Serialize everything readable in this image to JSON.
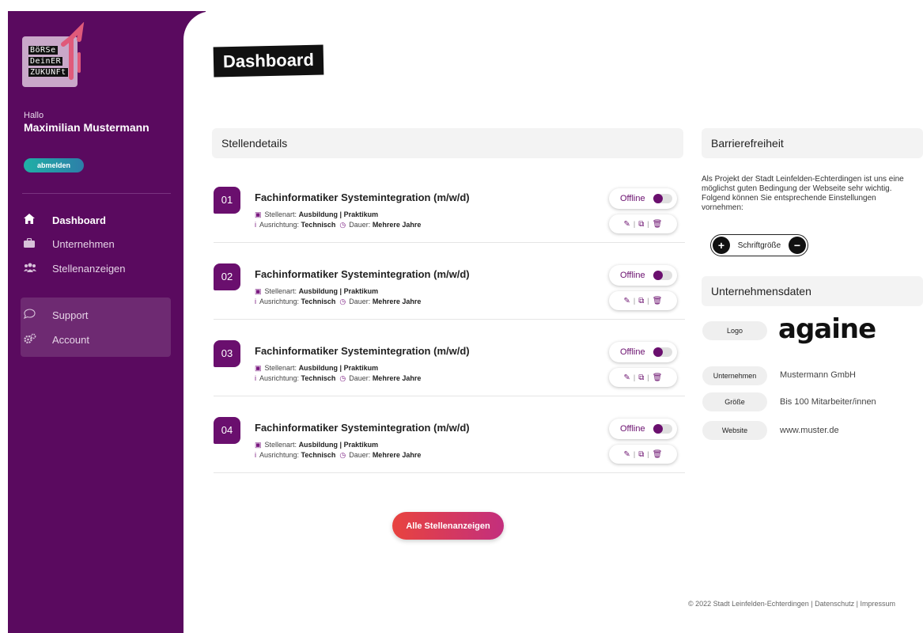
{
  "sidebar": {
    "logo_words": [
      "BöRSe",
      "DeinER",
      "ZUKUNFt"
    ],
    "greeting": "Hallo",
    "user_name": "Maximilian Mustermann",
    "logout_label": "abmelden",
    "nav": [
      {
        "label": "Dashboard",
        "icon": "home-icon",
        "active": true
      },
      {
        "label": "Unternehmen",
        "icon": "briefcase-icon",
        "active": false
      },
      {
        "label": "Stellenanzeigen",
        "icon": "users-icon",
        "active": false
      }
    ],
    "nav_secondary": [
      {
        "label": "Support",
        "icon": "chat-icon"
      },
      {
        "label": "Account",
        "icon": "gears-icon"
      }
    ]
  },
  "page_title": "Dashboard",
  "jobs_panel": {
    "title": "Stellendetails",
    "items": [
      {
        "num": "01",
        "title": "Fachinformatiker Systemintegration (m/w/d)",
        "type_label": "Stellenart:",
        "type_value": "Ausbildung | Praktikum",
        "direction_label": "Ausrichtung:",
        "direction_value": "Technisch",
        "duration_label": "Dauer:",
        "duration_value": "Mehrere Jahre",
        "status": "Offline"
      },
      {
        "num": "02",
        "title": "Fachinformatiker Systemintegration (m/w/d)",
        "type_label": "Stellenart:",
        "type_value": "Ausbildung | Praktikum",
        "direction_label": "Ausrichtung:",
        "direction_value": "Technisch",
        "duration_label": "Dauer:",
        "duration_value": "Mehrere Jahre",
        "status": "Offline"
      },
      {
        "num": "03",
        "title": "Fachinformatiker Systemintegration (m/w/d)",
        "type_label": "Stellenart:",
        "type_value": "Ausbildung | Praktikum",
        "direction_label": "Ausrichtung:",
        "direction_value": "Technisch",
        "duration_label": "Dauer:",
        "duration_value": "Mehrere Jahre",
        "status": "Offline"
      },
      {
        "num": "04",
        "title": "Fachinformatiker Systemintegration (m/w/d)",
        "type_label": "Stellenart:",
        "type_value": "Ausbildung | Praktikum",
        "direction_label": "Ausrichtung:",
        "direction_value": "Technisch",
        "duration_label": "Dauer:",
        "duration_value": "Mehrere Jahre",
        "status": "Offline"
      }
    ],
    "all_button": "Alle Stellenanzeigen"
  },
  "accessibility": {
    "title": "Barrierefreiheit",
    "text": "Als Projekt der Stadt Leinfelden-Echterdingen ist uns eine möglichst guten Bedingung der Webseite sehr wichtig. Folgend können Sie entsprechende Einstellungen vornehmen:",
    "font_size_label": "Schriftgröße",
    "plus": "+",
    "minus": "−"
  },
  "company": {
    "title": "Unternehmensdaten",
    "logo_label": "Logo",
    "logo_text": "againe",
    "rows": [
      {
        "label": "Unternehmen",
        "value": "Mustermann GmbH"
      },
      {
        "label": "Größe",
        "value": "Bis 100 Mitarbeiter/innen"
      },
      {
        "label": "Website",
        "value": "www.muster.de"
      }
    ]
  },
  "footer": "© 2022 Stadt Leinfelden-Echterdingen | Datenschutz | Impressum",
  "colors": {
    "primary": "#5a0a5f",
    "accent": "#6a0f6e",
    "button_gradient": [
      "#e8433f",
      "#c32f7d"
    ]
  }
}
